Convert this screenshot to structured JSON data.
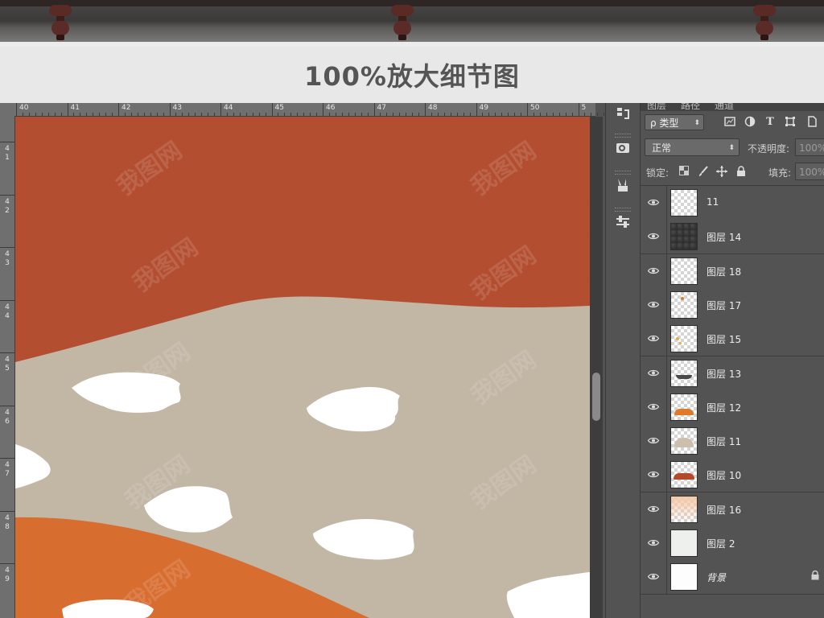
{
  "banner": {
    "title": "100%放大细节图"
  },
  "ruler": {
    "top_labels": [
      "40",
      "41",
      "42",
      "43",
      "44",
      "45",
      "46",
      "47",
      "48",
      "49",
      "50",
      "5"
    ],
    "left_labels": [
      [
        "4",
        "1"
      ],
      [
        "4",
        "2"
      ],
      [
        "4",
        "3"
      ],
      [
        "4",
        "4"
      ],
      [
        "4",
        "5"
      ],
      [
        "4",
        "6"
      ],
      [
        "4",
        "7"
      ],
      [
        "4",
        "8"
      ],
      [
        "4",
        "9"
      ]
    ]
  },
  "panel": {
    "tabs": [
      "图层",
      "路径",
      "通道"
    ],
    "kind_label": "ρ 类型",
    "blend_mode": "正常",
    "opacity_label": "不透明度:",
    "opacity_value": "100%",
    "lock_label": "锁定:",
    "fill_label": "填充:",
    "fill_value": "100%"
  },
  "layers": [
    {
      "name": "11",
      "thumb": "transparent",
      "visible": true
    },
    {
      "name": "图层 14",
      "thumb": "dark-texture",
      "visible": true
    },
    {
      "name": "图层 18",
      "thumb": "transparent",
      "visible": true
    },
    {
      "name": "图层 17",
      "thumb": "orange-dot",
      "visible": true
    },
    {
      "name": "图层 15",
      "thumb": "yellow-dots",
      "visible": true
    },
    {
      "name": "图层 13",
      "thumb": "dark-boat",
      "visible": true
    },
    {
      "name": "图层 12",
      "thumb": "orange-hill",
      "visible": true
    },
    {
      "name": "图层 11",
      "thumb": "beige-hill",
      "visible": true
    },
    {
      "name": "图层 10",
      "thumb": "rust-hill",
      "visible": true
    },
    {
      "name": "图层 16",
      "thumb": "peach-gradient",
      "visible": true
    },
    {
      "name": "图层 2",
      "thumb": "light",
      "visible": true
    },
    {
      "name": "背景",
      "thumb": "white",
      "visible": true,
      "locked": true
    }
  ],
  "colors": {
    "rust": "#b24a2c",
    "beige": "#c1b5a4",
    "orange": "#d86a2c",
    "panel_bg": "#535353"
  },
  "watermark": "我图网"
}
